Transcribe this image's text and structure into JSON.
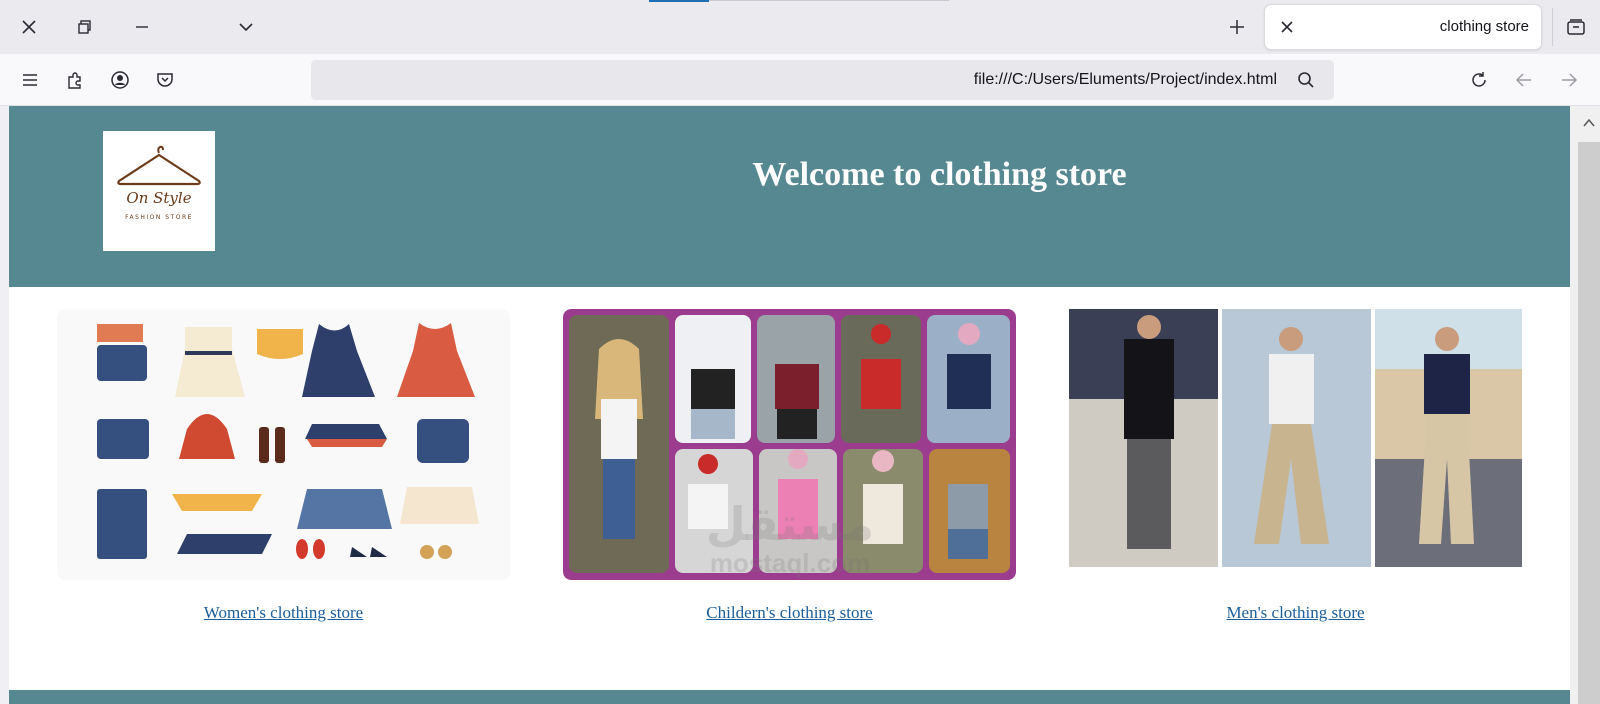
{
  "browser": {
    "tab_title": "clothing store",
    "url": "file:///C:/Users/Eluments/Project/index.html"
  },
  "page": {
    "heading": "Welcome to clothing store",
    "logo": {
      "line1": "On Style",
      "line2": "FASHION STORE"
    },
    "stores": [
      {
        "label": "Women's clothing store"
      },
      {
        "label": "Childern's clothing store"
      },
      {
        "label": "Men's clothing store"
      }
    ]
  },
  "watermark": {
    "arabic": "مستقل",
    "latin": "mostaql.com"
  },
  "colors": {
    "header_bg": "#558890",
    "link": "#1b5e99",
    "kids_frame": "#9b3c8e"
  }
}
